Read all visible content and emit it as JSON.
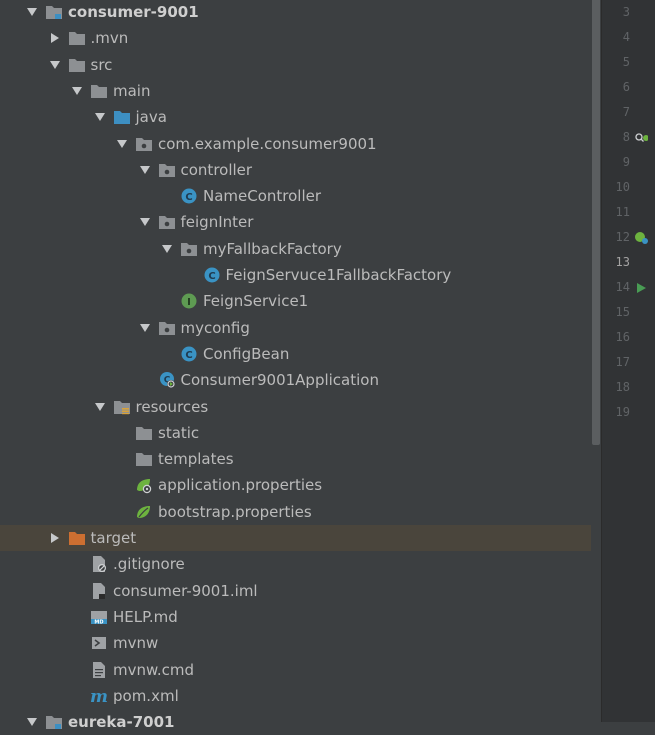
{
  "tree": [
    {
      "label": "consumer-9001",
      "indent": 0,
      "arrow": "down",
      "icon": "module-folder",
      "bold": true
    },
    {
      "label": ".mvn",
      "indent": 1,
      "arrow": "right",
      "icon": "folder"
    },
    {
      "label": "src",
      "indent": 1,
      "arrow": "down",
      "icon": "folder"
    },
    {
      "label": "main",
      "indent": 2,
      "arrow": "down",
      "icon": "folder"
    },
    {
      "label": "java",
      "indent": 3,
      "arrow": "down",
      "icon": "source-folder"
    },
    {
      "label": "com.example.consumer9001",
      "indent": 4,
      "arrow": "down",
      "icon": "package"
    },
    {
      "label": "controller",
      "indent": 5,
      "arrow": "down",
      "icon": "package"
    },
    {
      "label": "NameController",
      "indent": 6,
      "arrow": "none",
      "icon": "class"
    },
    {
      "label": "feignInter",
      "indent": 5,
      "arrow": "down",
      "icon": "package"
    },
    {
      "label": "myFallbackFactory",
      "indent": 6,
      "arrow": "down",
      "icon": "package"
    },
    {
      "label": "FeignServuce1FallbackFactory",
      "indent": 7,
      "arrow": "none",
      "icon": "class"
    },
    {
      "label": "FeignService1",
      "indent": 6,
      "arrow": "none",
      "icon": "interface"
    },
    {
      "label": "myconfig",
      "indent": 5,
      "arrow": "down",
      "icon": "package"
    },
    {
      "label": "ConfigBean",
      "indent": 6,
      "arrow": "none",
      "icon": "class"
    },
    {
      "label": "Consumer9001Application",
      "indent": 5,
      "arrow": "none",
      "icon": "spring-app"
    },
    {
      "label": "resources",
      "indent": 3,
      "arrow": "down",
      "icon": "resources-folder"
    },
    {
      "label": "static",
      "indent": 4,
      "arrow": "none",
      "icon": "folder"
    },
    {
      "label": "templates",
      "indent": 4,
      "arrow": "none",
      "icon": "folder"
    },
    {
      "label": "application.properties",
      "indent": 4,
      "arrow": "none",
      "icon": "spring-properties"
    },
    {
      "label": "bootstrap.properties",
      "indent": 4,
      "arrow": "none",
      "icon": "spring-leaf"
    },
    {
      "label": "target",
      "indent": 1,
      "arrow": "right",
      "icon": "excluded-folder",
      "selected": true
    },
    {
      "label": ".gitignore",
      "indent": 2,
      "arrow": "none",
      "icon": "ignore-file"
    },
    {
      "label": "consumer-9001.iml",
      "indent": 2,
      "arrow": "none",
      "icon": "iml-file"
    },
    {
      "label": "HELP.md",
      "indent": 2,
      "arrow": "none",
      "icon": "markdown-file"
    },
    {
      "label": "mvnw",
      "indent": 2,
      "arrow": "none",
      "icon": "shell-file"
    },
    {
      "label": "mvnw.cmd",
      "indent": 2,
      "arrow": "none",
      "icon": "text-file"
    },
    {
      "label": "pom.xml",
      "indent": 2,
      "arrow": "none",
      "icon": "maven-file"
    },
    {
      "label": "eureka-7001",
      "indent": 0,
      "arrow": "down",
      "icon": "module-folder",
      "bold": true
    }
  ],
  "gutter": {
    "lines": [
      "3",
      "4",
      "5",
      "6",
      "7",
      "8",
      "9",
      "10",
      "11",
      "12",
      "13",
      "14",
      "15",
      "16",
      "17",
      "18",
      "19"
    ],
    "current_line": "13",
    "markers": [
      {
        "line": "8",
        "icon": "find-bean-icon"
      },
      {
        "line": "12",
        "icon": "bean-icon"
      },
      {
        "line": "14",
        "icon": "run-icon"
      }
    ]
  },
  "colors": {
    "panel_bg": "#3c3f41",
    "gutter_bg": "#313335",
    "selected_row": "#4a453c",
    "folder": "#8d9093",
    "source_folder": "#3d8fc2",
    "excluded_folder": "#cd6f31",
    "class_icon": "#3a93c4",
    "interface_icon": "#5e9b52",
    "spring_green": "#6db33f"
  }
}
